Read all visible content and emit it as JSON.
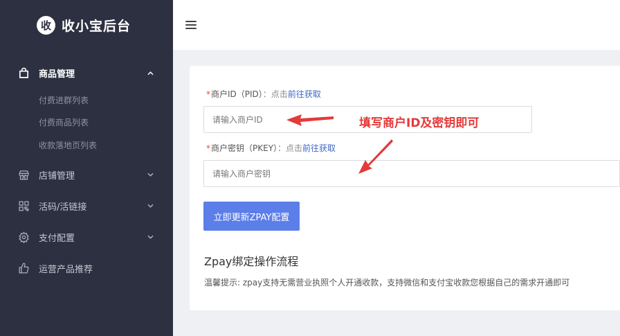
{
  "brand": {
    "logo_char": "收",
    "title": "收小宝后台"
  },
  "sidebar": {
    "items": [
      {
        "label": "商品管理",
        "icon": "bag-icon",
        "expanded": true,
        "children": [
          "付费进群列表",
          "付费商品列表",
          "收款落地页列表"
        ]
      },
      {
        "label": "店铺管理",
        "icon": "store-icon",
        "expanded": false
      },
      {
        "label": "活码/活链接",
        "icon": "qrcode-icon",
        "expanded": false
      },
      {
        "label": "支付配置",
        "icon": "gear-icon",
        "expanded": false
      },
      {
        "label": "运营产品推荐",
        "icon": "thumbs-up-icon",
        "expanded": false
      }
    ]
  },
  "form": {
    "pid": {
      "required_mark": "*",
      "label": "商户ID（PID）",
      "hint": "：点击",
      "link": "前往获取",
      "placeholder": "请输入商户ID"
    },
    "pkey": {
      "required_mark": "*",
      "label": "商户密钥（PKEY）",
      "hint": "：点击",
      "link": "前往获取",
      "placeholder": "请输入商户密钥"
    },
    "submit_label": "立即更新ZPAY配置"
  },
  "annotation": {
    "text": "填写商户ID及密钥即可",
    "color": "#e33a3a"
  },
  "guide": {
    "title": "Zpay绑定操作流程",
    "tip": "温馨提示: zpay支持无需营业执照个人开通收款，支持微信和支付宝收款您根据自己的需求开通即可"
  },
  "colors": {
    "sidebar_bg": "#2c3040",
    "primary": "#5b7ee8",
    "link": "#3e67c8",
    "required": "#e54b4b"
  }
}
